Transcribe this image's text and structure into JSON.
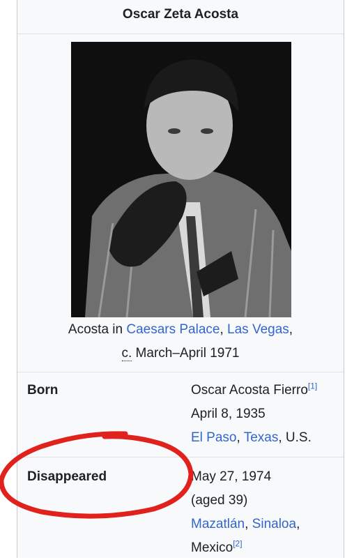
{
  "infobox": {
    "title": "Oscar Zeta Acosta",
    "caption": {
      "prefix": "Acosta in ",
      "link1": "Caesars Palace",
      "comma": ", ",
      "link2": "Las Vegas",
      "after": ",",
      "circa": "c.",
      "date": " March–April 1971"
    },
    "born": {
      "label": "Born",
      "name": "Oscar Acosta Fierro",
      "ref": "[1]",
      "date": "April 8, 1935",
      "place_link1": "El Paso",
      "comma": ", ",
      "place_link2": "Texas",
      "place_suffix": ", U.S."
    },
    "disappeared": {
      "label": "Disappeared",
      "date": "May 27, 1974",
      "age": "(aged 39)",
      "place_link1": "Mazatlán",
      "comma": ", ",
      "place_link2": "Sinaloa",
      "after": ",",
      "country": "Mexico",
      "ref": "[2]"
    }
  },
  "colors": {
    "link": "#3366cc",
    "annotation": "#e0211c",
    "background": "#f8f9fa"
  }
}
